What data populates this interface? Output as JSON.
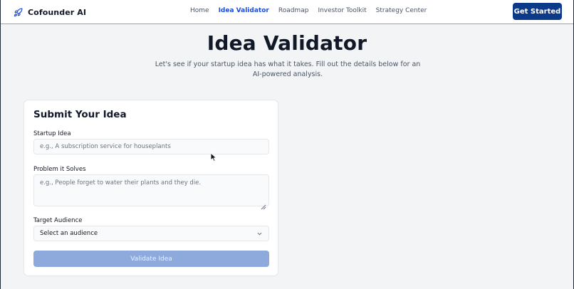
{
  "header": {
    "brand_name": "Cofounder AI",
    "nav": [
      {
        "label": "Home"
      },
      {
        "label": "Idea Validator",
        "active": true
      },
      {
        "label": "Roadmap"
      },
      {
        "label": "Investor Toolkit"
      },
      {
        "label": "Strategy Center"
      }
    ],
    "cta_label": "Get Started",
    "brand_color": "#0b3a8a",
    "active_color": "#1d4ed8"
  },
  "hero": {
    "title": "Idea Validator",
    "subtitle": "Let's see if your startup idea has what it takes. Fill out the details below for an AI-powered analysis."
  },
  "form": {
    "title": "Submit Your Idea",
    "startup_idea": {
      "label": "Startup Idea",
      "value": "",
      "placeholder": "e.g., A subscription service for houseplants"
    },
    "problem": {
      "label": "Problem it Solves",
      "value": "",
      "placeholder": "e.g., People forget to water their plants and they die."
    },
    "audience": {
      "label": "Target Audience",
      "selected": "Select an audience"
    },
    "submit_label": "Validate Idea",
    "submit_color": "#8ea9db"
  },
  "icons": {
    "brand": "rocket-icon",
    "select": "chevron-down-icon",
    "textarea": "resize-grip-icon",
    "pointer": "mouse-pointer-icon"
  }
}
